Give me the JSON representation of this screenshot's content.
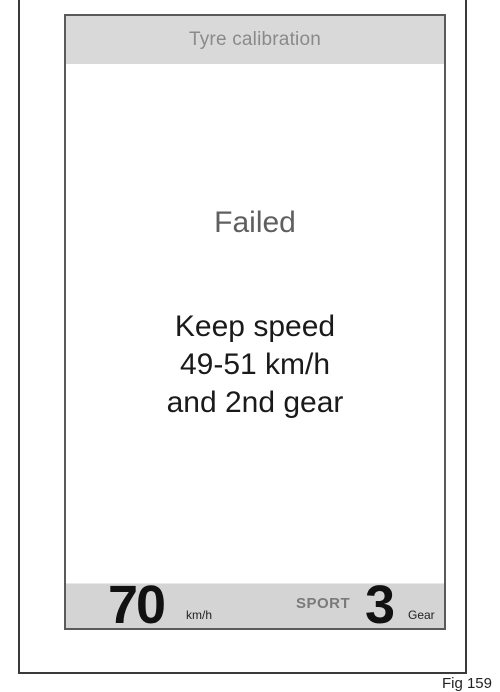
{
  "display": {
    "title": "Tyre calibration",
    "status": "Failed",
    "message": {
      "line1": "Keep speed",
      "line2": "49-51 km/h",
      "line3": "and 2nd gear"
    },
    "footer": {
      "speed": "70",
      "speed_unit": "km/h",
      "mode": "SPORT",
      "gear": "3",
      "gear_label": "Gear"
    }
  },
  "figure_label": "Fig 159",
  "colors": {
    "title_bar_bg": "#d9d9d9",
    "title_text": "#8a8a8a",
    "status_text": "#5f5f5f",
    "footer_bg": "#d4d4d4",
    "mode_text": "#7a7a7a"
  }
}
